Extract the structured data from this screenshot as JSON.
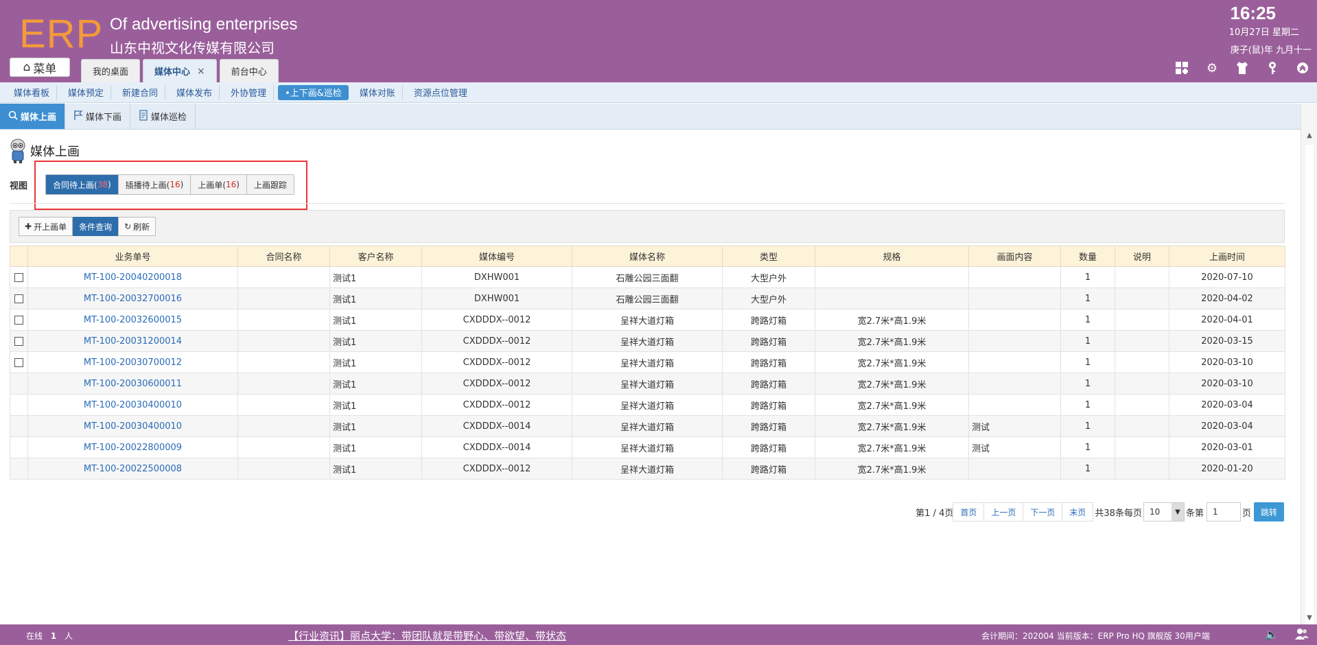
{
  "header": {
    "logo": "ERP",
    "company_en": "Of advertising enterprises",
    "company_cn": "山东中视文化传媒有限公司",
    "time": "16:25",
    "date": "10月27日 星期二",
    "lunar": "庚子(鼠)年 九月十一",
    "menu_label": "菜单"
  },
  "top_tabs": [
    {
      "label": "我的桌面"
    },
    {
      "label": "媒体中心",
      "close": "×"
    },
    {
      "label": "前台中心"
    }
  ],
  "header_icons": [
    "add-widget-icon",
    "gear-icon",
    "clothes-icon",
    "key-icon",
    "collapse-icon"
  ],
  "nav": [
    {
      "label": "媒体看板"
    },
    {
      "label": "媒体预定"
    },
    {
      "label": "新建合同"
    },
    {
      "label": "媒体发布"
    },
    {
      "label": "外协管理"
    },
    {
      "label": "•上下画&巡检"
    },
    {
      "label": "媒体对账"
    },
    {
      "label": "资源点位管理"
    }
  ],
  "subtabs": [
    {
      "label": "媒体上画"
    },
    {
      "label": "媒体下画"
    },
    {
      "label": "媒体巡检"
    }
  ],
  "page": {
    "title": "媒体上画",
    "view_label": "视图",
    "views": [
      {
        "label": "合同待上画(",
        "count": "38",
        "close": ")"
      },
      {
        "label": "插播待上画(",
        "count": "16",
        "close": ")"
      },
      {
        "label": "上画单(",
        "count": "16",
        "close": ")"
      },
      {
        "label": "上画跟踪"
      }
    ]
  },
  "toolbar": {
    "open": "开上画单",
    "query": "条件查询",
    "refresh": "刷新"
  },
  "table": {
    "headers": [
      "",
      "业务单号",
      "合同名称",
      "客户名称",
      "媒体编号",
      "媒体名称",
      "类型",
      "规格",
      "画面内容",
      "数量",
      "说明",
      "上画时间"
    ],
    "rows": [
      {
        "cb": true,
        "no": "MT-100-20040200018",
        "contract": "",
        "client": "测试1",
        "code": "DXHW001",
        "name": "石雕公园三面翻",
        "type": "大型户外",
        "spec": "",
        "content": "",
        "qty": "1",
        "note": "",
        "time": "2020-07-10"
      },
      {
        "cb": true,
        "no": "MT-100-20032700016",
        "contract": "",
        "client": "测试1",
        "code": "DXHW001",
        "name": "石雕公园三面翻",
        "type": "大型户外",
        "spec": "",
        "content": "",
        "qty": "1",
        "note": "",
        "time": "2020-04-02"
      },
      {
        "cb": true,
        "no": "MT-100-20032600015",
        "contract": "",
        "client": "测试1",
        "code": "CXDDDX--0012",
        "name": "呈祥大道灯箱",
        "type": "跨路灯箱",
        "spec": "宽2.7米*高1.9米",
        "content": "",
        "qty": "1",
        "note": "",
        "time": "2020-04-01"
      },
      {
        "cb": true,
        "no": "MT-100-20031200014",
        "contract": "",
        "client": "测试1",
        "code": "CXDDDX--0012",
        "name": "呈祥大道灯箱",
        "type": "跨路灯箱",
        "spec": "宽2.7米*高1.9米",
        "content": "",
        "qty": "1",
        "note": "",
        "time": "2020-03-15"
      },
      {
        "cb": true,
        "no": "MT-100-20030700012",
        "contract": "",
        "client": "测试1",
        "code": "CXDDDX--0012",
        "name": "呈祥大道灯箱",
        "type": "跨路灯箱",
        "spec": "宽2.7米*高1.9米",
        "content": "",
        "qty": "1",
        "note": "",
        "time": "2020-03-10"
      },
      {
        "cb": false,
        "no": "MT-100-20030600011",
        "contract": "",
        "client": "测试1",
        "code": "CXDDDX--0012",
        "name": "呈祥大道灯箱",
        "type": "跨路灯箱",
        "spec": "宽2.7米*高1.9米",
        "content": "",
        "qty": "1",
        "note": "",
        "time": "2020-03-10"
      },
      {
        "cb": false,
        "no": "MT-100-20030400010",
        "contract": "",
        "client": "测试1",
        "code": "CXDDDX--0012",
        "name": "呈祥大道灯箱",
        "type": "跨路灯箱",
        "spec": "宽2.7米*高1.9米",
        "content": "",
        "qty": "1",
        "note": "",
        "time": "2020-03-04"
      },
      {
        "cb": false,
        "no": "MT-100-20030400010",
        "contract": "",
        "client": "测试1",
        "code": "CXDDDX--0014",
        "name": "呈祥大道灯箱",
        "type": "跨路灯箱",
        "spec": "宽2.7米*高1.9米",
        "content": "测试",
        "qty": "1",
        "note": "",
        "time": "2020-03-04"
      },
      {
        "cb": false,
        "no": "MT-100-20022800009",
        "contract": "",
        "client": "测试1",
        "code": "CXDDDX--0014",
        "name": "呈祥大道灯箱",
        "type": "跨路灯箱",
        "spec": "宽2.7米*高1.9米",
        "content": "测试",
        "qty": "1",
        "note": "",
        "time": "2020-03-01"
      },
      {
        "cb": false,
        "no": "MT-100-20022500008",
        "contract": "",
        "client": "测试1",
        "code": "CXDDDX--0012",
        "name": "呈祥大道灯箱",
        "type": "跨路灯箱",
        "spec": "宽2.7米*高1.9米",
        "content": "",
        "qty": "1",
        "note": "",
        "time": "2020-01-20"
      }
    ]
  },
  "pager": {
    "page_info": "第1 / 4页",
    "first": "首页",
    "prev": "上一页",
    "next": "下一页",
    "last": "末页",
    "total": "共38条每页",
    "page_size": "10",
    "per_page_unit": "条第",
    "page_input": "1",
    "page_unit": "页",
    "go": "跳转"
  },
  "footer": {
    "online": "在线",
    "online_count": "1",
    "online_unit": "人",
    "ticker": "【行业资讯】丽点大学：带团队就是带野心、带欲望、带状态",
    "sysinfo": "会计期间：202004 当前版本：ERP Pro HQ 旗舰版 30用户端"
  },
  "colors": {
    "header": "#9a5f9b",
    "logo": "#f39a3b",
    "accent": "#3d8fd1",
    "highlight": "#e33333"
  }
}
